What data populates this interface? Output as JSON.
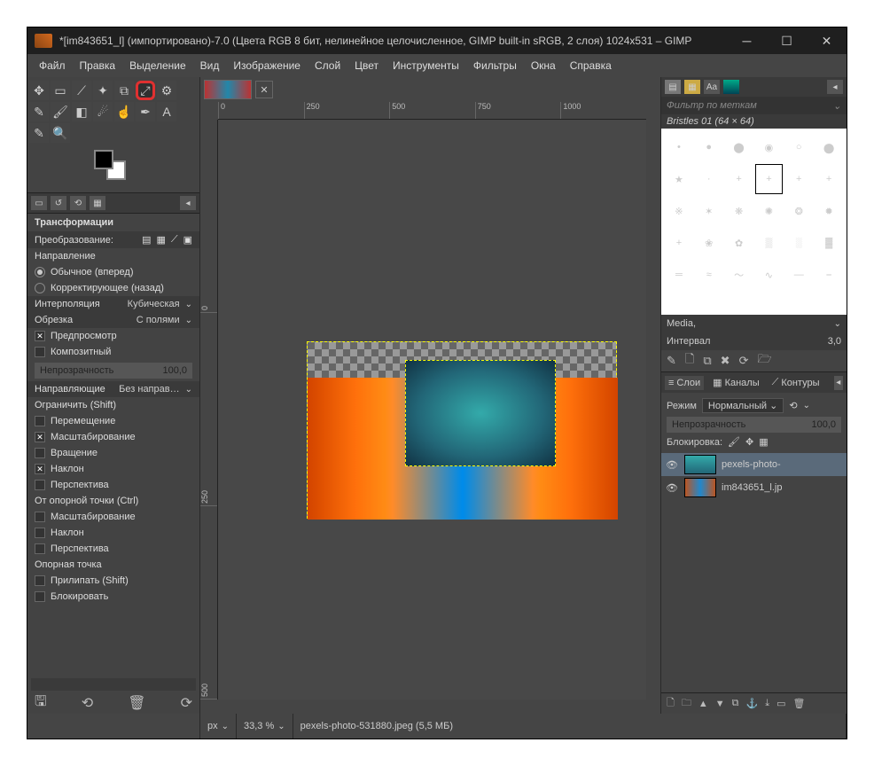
{
  "title": "*[im843651_l] (импортировано)-7.0 (Цвета RGB 8 бит, нелинейное целочисленное, GIMP built-in sRGB, 2 слоя) 1024x531 – GIMP",
  "menu": [
    "Файл",
    "Правка",
    "Выделение",
    "Вид",
    "Изображение",
    "Слой",
    "Цвет",
    "Инструменты",
    "Фильтры",
    "Окна",
    "Справка"
  ],
  "ruler_h": [
    "0",
    "250",
    "500",
    "750",
    "1000"
  ],
  "ruler_v": [
    "0",
    "250",
    "500"
  ],
  "tool_options": {
    "header": "Трансформации",
    "transform_label": "Преобразование:",
    "direction_label": "Направление",
    "dir_normal": "Обычное (вперед)",
    "dir_corrective": "Корректирующее (назад)",
    "interp_label": "Интерполяция",
    "interp_value": "Кубическая",
    "crop_label": "Обрезка",
    "crop_value": "С полями",
    "preview": "Предпросмотр",
    "composite": "Композитный",
    "opacity_label": "Непрозрачность",
    "opacity_value": "100,0",
    "guides_label": "Направляющие",
    "guides_value": "Без направ…",
    "constrain": "Ограничить (Shift)",
    "move": "Перемещение",
    "scale": "Масштабирование",
    "rotate": "Вращение",
    "shear": "Наклон",
    "perspective": "Перспектива",
    "from_pivot": "От опорной точки (Ctrl)",
    "pivot": "Опорная точка",
    "snap": "Прилипать (Shift)",
    "lock": "Блокировать"
  },
  "status": {
    "unit": "px",
    "zoom": "33,3 %",
    "file": "pexels-photo-531880.jpeg (5,5 МБ)"
  },
  "brushes": {
    "filter_placeholder": "Фильтр по меткам",
    "name": "Bristles 01 (64 × 64)",
    "preset": "Media,",
    "interval_label": "Интервал",
    "interval_value": "3,0"
  },
  "layers": {
    "tab_layers": "Слои",
    "tab_channels": "Каналы",
    "tab_paths": "Контуры",
    "mode_label": "Режим",
    "mode_value": "Нормальный",
    "opacity_label": "Непрозрачность",
    "opacity_value": "100,0",
    "lock_label": "Блокировка:",
    "items": [
      {
        "name": "pexels-photo-"
      },
      {
        "name": "im843651_l.jp"
      }
    ]
  }
}
